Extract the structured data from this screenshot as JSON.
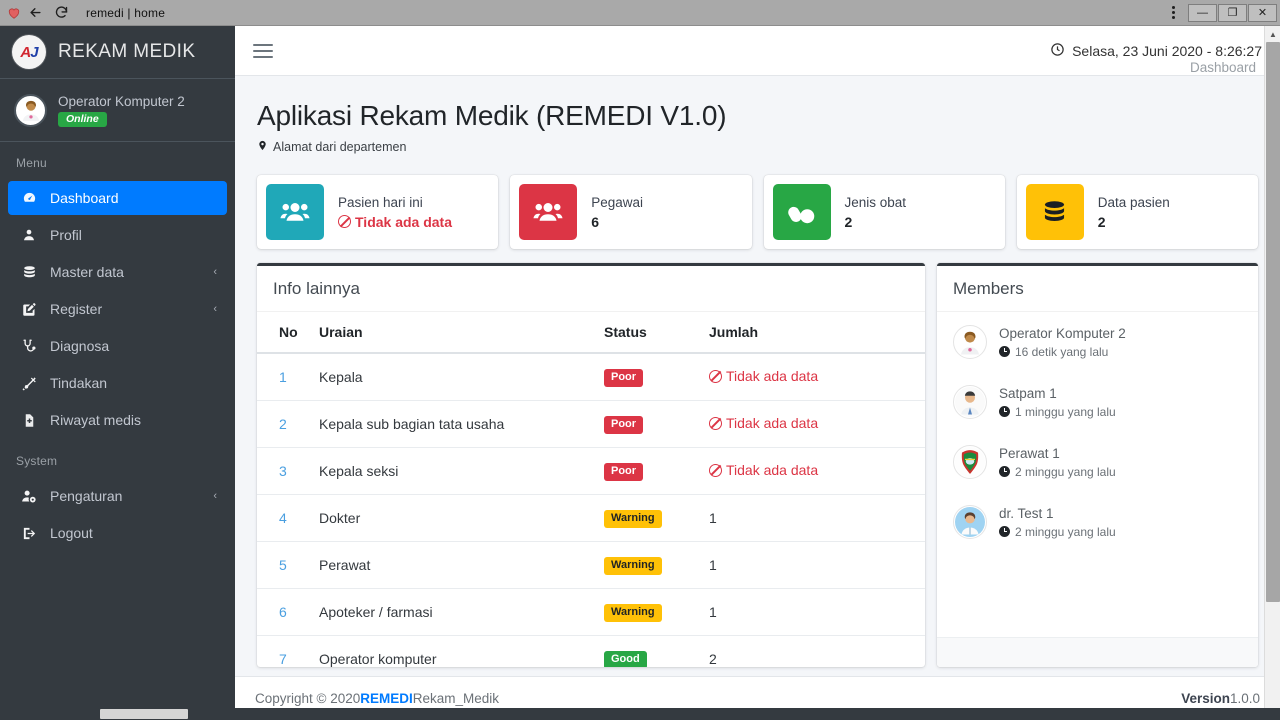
{
  "browser": {
    "favicon_icon": "heart-favicon",
    "back_icon": "back-arrow-icon",
    "reload_icon": "reload-icon",
    "url": "remedi | home",
    "kebab_icon": "kebab-menu-icon",
    "minimize_label": "—",
    "maximize_label": "❐",
    "close_label": "✕"
  },
  "sidebar": {
    "brand": {
      "logo_letter_a": "A",
      "logo_letter_j": "J",
      "title": "REKAM MEDIK"
    },
    "user": {
      "avatar_icon": "user-avatar",
      "name": "Operator Komputer 2",
      "status": "Online"
    },
    "menu_header": "Menu",
    "items": [
      {
        "label": "Dashboard",
        "icon": "dashboard-icon",
        "active": true,
        "caret": ""
      },
      {
        "label": "Profil",
        "icon": "user-icon",
        "active": false,
        "caret": ""
      },
      {
        "label": "Master data",
        "icon": "database-icon",
        "active": false,
        "caret": "‹"
      },
      {
        "label": "Register",
        "icon": "edit-square-icon",
        "active": false,
        "caret": "‹"
      },
      {
        "label": "Diagnosa",
        "icon": "stethoscope-icon",
        "active": false,
        "caret": ""
      },
      {
        "label": "Tindakan",
        "icon": "syringe-icon",
        "active": false,
        "caret": ""
      },
      {
        "label": "Riwayat medis",
        "icon": "file-medical-icon",
        "active": false,
        "caret": ""
      }
    ],
    "system_header": "System",
    "system_items": [
      {
        "label": "Pengaturan",
        "icon": "user-gear-icon",
        "active": false,
        "caret": "‹"
      },
      {
        "label": "Logout",
        "icon": "logout-icon",
        "active": false,
        "caret": ""
      }
    ]
  },
  "topbar": {
    "hamburger_icon": "hamburger-icon",
    "clock_icon": "clock-icon",
    "datetime": "Selasa, 23 Juni 2020 - 8:26:27"
  },
  "page": {
    "title": "Aplikasi Rekam Medik (REMEDI V1.0)",
    "subtitle": "Alamat dari departemen",
    "location_icon": "map-pin-icon",
    "breadcrumb": "Dashboard"
  },
  "cards": [
    {
      "label": "Pasien hari ini",
      "value": "Tidak ada data",
      "nodata": true,
      "color": "#20a8b8",
      "icon": "users-icon"
    },
    {
      "label": "Pegawai",
      "value": "6",
      "nodata": false,
      "color": "#dc3545",
      "icon": "users-icon"
    },
    {
      "label": "Jenis obat",
      "value": "2",
      "nodata": false,
      "color": "#28a745",
      "icon": "pills-icon"
    },
    {
      "label": "Data pasien",
      "value": "2",
      "nodata": false,
      "color": "#ffc107",
      "icon": "database-icon"
    }
  ],
  "info_panel": {
    "title": "Info lainnya",
    "columns": [
      "No",
      "Uraian",
      "Status",
      "Jumlah"
    ],
    "rows": [
      {
        "no": "1",
        "uraian": "Kepala",
        "status": "Poor",
        "status_type": "danger",
        "jumlah": "Tidak ada data",
        "jumlah_nodata": true
      },
      {
        "no": "2",
        "uraian": "Kepala sub bagian tata usaha",
        "status": "Poor",
        "status_type": "danger",
        "jumlah": "Tidak ada data",
        "jumlah_nodata": true
      },
      {
        "no": "3",
        "uraian": "Kepala seksi",
        "status": "Poor",
        "status_type": "danger",
        "jumlah": "Tidak ada data",
        "jumlah_nodata": true
      },
      {
        "no": "4",
        "uraian": "Dokter",
        "status": "Warning",
        "status_type": "warning",
        "jumlah": "1",
        "jumlah_nodata": false
      },
      {
        "no": "5",
        "uraian": "Perawat",
        "status": "Warning",
        "status_type": "warning",
        "jumlah": "1",
        "jumlah_nodata": false
      },
      {
        "no": "6",
        "uraian": "Apoteker / farmasi",
        "status": "Warning",
        "status_type": "warning",
        "jumlah": "1",
        "jumlah_nodata": false
      },
      {
        "no": "7",
        "uraian": "Operator komputer",
        "status": "Good",
        "status_type": "success",
        "jumlah": "2",
        "jumlah_nodata": false
      }
    ]
  },
  "members_panel": {
    "title": "Members",
    "members": [
      {
        "name": "Operator Komputer 2",
        "time": "16 detik yang lalu",
        "avatar_icon": "member-avatar-operator"
      },
      {
        "name": "Satpam 1",
        "time": "1 minggu yang lalu",
        "avatar_icon": "member-avatar-satpam"
      },
      {
        "name": "Perawat 1",
        "time": "2 minggu yang lalu",
        "avatar_icon": "member-avatar-perawat"
      },
      {
        "name": "dr. Test 1",
        "time": "2 minggu yang lalu",
        "avatar_icon": "member-avatar-dokter"
      }
    ]
  },
  "footer": {
    "copyright_prefix": "Copyright © 2020 ",
    "brand": "REMEDI",
    "brand_suffix": "Rekam_Medik",
    "version_label": "Version ",
    "version_number": "1.0.0"
  },
  "colors": {
    "sidebar_bg": "#343a40",
    "accent": "#007bff",
    "danger": "#dc3545",
    "warning": "#ffc107",
    "success": "#28a745",
    "teal": "#20a8b8"
  }
}
